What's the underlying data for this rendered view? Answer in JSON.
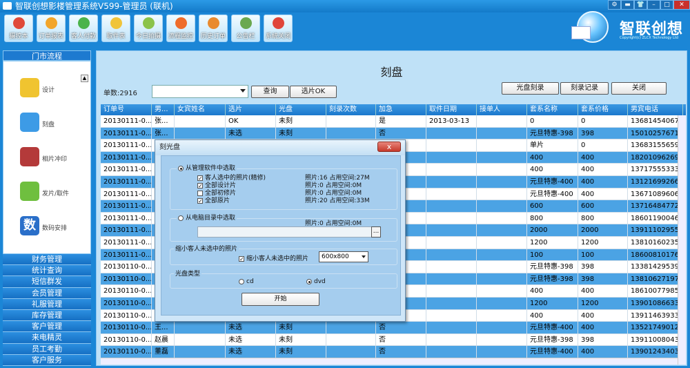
{
  "window": {
    "title": "智联创想影楼管理系统V599-管理员 (联机)",
    "buttons": [
      "⚙",
      "▬",
      "👕",
      "–",
      "□",
      "✕"
    ]
  },
  "toolbar": [
    {
      "label": "摄控本",
      "color": "#e04a3a"
    },
    {
      "label": "订单报表",
      "color": "#f2a52a"
    },
    {
      "label": "客人付款",
      "color": "#4bb34b"
    },
    {
      "label": "取件表",
      "color": "#f0c43a"
    },
    {
      "label": "今日拍摄",
      "color": "#8bc34a"
    },
    {
      "label": "流程监控",
      "color": "#ef6c2a"
    },
    {
      "label": "历史订单",
      "color": "#e98a2e"
    },
    {
      "label": "公告栏",
      "color": "#6aa84f"
    },
    {
      "label": "系统关闭",
      "color": "#e0453a"
    }
  ],
  "logo": {
    "name": "智联创想",
    "sub": "Copyright(c) ZLCX Technology Ltd"
  },
  "sidebar": {
    "header": "门市流程",
    "panel_items": [
      {
        "label": "设计",
        "icon": "design-icon",
        "color": "#f0c430"
      },
      {
        "label": "刻盘",
        "icon": "disc-icon",
        "color": "#3d9be6"
      },
      {
        "label": "相片冲印",
        "icon": "photo-print-icon",
        "color": "#b43a3a"
      },
      {
        "label": "发片/取件",
        "icon": "pickup-icon",
        "color": "#6fbf3f"
      },
      {
        "label": "数码安排",
        "icon": "digital-icon",
        "color": "#2a6fc9"
      }
    ],
    "digital_glyph": "数",
    "menu": [
      "财务管理",
      "统计查询",
      "短信群发",
      "会员管理",
      "礼服管理",
      "库存管理",
      "客户管理",
      "来电精灵",
      "员工考勤",
      "客户服务"
    ]
  },
  "main": {
    "title": "刻盘",
    "count_label": "单数:2916",
    "buttons": {
      "query": "查询",
      "select": "选片OK",
      "burn": "光盘刻录",
      "record": "刻录记录",
      "close": "关闭"
    },
    "columns": [
      "订单号",
      "男...",
      "女宾姓名",
      "选片",
      "光盘",
      "刻录次数",
      "加急",
      "取件日期",
      "接单人",
      "套系名称",
      "套系价格",
      "男宾电话"
    ],
    "rows": [
      [
        "20130111-0...",
        "张...",
        "",
        "OK",
        "未刻",
        "",
        "是",
        "2013-03-13",
        "",
        "0",
        "0",
        "13681454067"
      ],
      [
        "20130111-0...",
        "张...",
        "",
        "未选",
        "未刻",
        "",
        "否",
        "",
        "",
        "元旦特惠-398",
        "398",
        "15010257671"
      ],
      [
        "20130111-0...",
        "",
        "",
        "",
        "",
        "",
        "",
        "",
        "",
        "单片",
        "0",
        "13683155659"
      ],
      [
        "20130111-0...",
        "",
        "",
        "",
        "",
        "",
        "",
        "",
        "",
        "400",
        "400",
        "18201096269"
      ],
      [
        "20130111-0...",
        "",
        "",
        "",
        "",
        "",
        "",
        "",
        "",
        "400",
        "400",
        "13717555333"
      ],
      [
        "20130111-0...",
        "",
        "",
        "",
        "",
        "",
        "",
        "",
        "",
        "元旦特惠-400",
        "400",
        "13121699266"
      ],
      [
        "20130111-0...",
        "",
        "",
        "",
        "",
        "",
        "",
        "",
        "",
        "元旦特惠-400",
        "400",
        "13671089606"
      ],
      [
        "20130111-0...",
        "",
        "",
        "",
        "",
        "",
        "",
        "",
        "",
        "600",
        "600",
        "13716484772"
      ],
      [
        "20130111-0...",
        "",
        "",
        "",
        "",
        "",
        "",
        "",
        "",
        "800",
        "800",
        "18601190046"
      ],
      [
        "20130111-0...",
        "",
        "",
        "",
        "",
        "",
        "",
        "",
        "",
        "2000",
        "2000",
        "13911102955"
      ],
      [
        "20130111-0...",
        "",
        "",
        "",
        "",
        "",
        "",
        "",
        "",
        "1200",
        "1200",
        "13810160235"
      ],
      [
        "20130111-0...",
        "",
        "",
        "",
        "",
        "",
        "",
        "",
        "",
        "100",
        "100",
        "18600810176"
      ],
      [
        "20130110-0...",
        "",
        "",
        "",
        "",
        "",
        "",
        "",
        "",
        "元旦特惠-398",
        "398",
        "13381429539"
      ],
      [
        "20130110-0...",
        "",
        "",
        "",
        "",
        "",
        "",
        "",
        "",
        "元旦特惠-398",
        "398",
        "13810627197"
      ],
      [
        "20130110-0...",
        "",
        "",
        "",
        "",
        "",
        "",
        "",
        "",
        "400",
        "400",
        "18610077985"
      ],
      [
        "20130110-0...",
        "",
        "",
        "",
        "",
        "",
        "",
        "",
        "",
        "1200",
        "1200",
        "13901086633"
      ],
      [
        "20130110-0...",
        "",
        "",
        "",
        "",
        "",
        "",
        "",
        "",
        "400",
        "400",
        "13911463933"
      ],
      [
        "20130110-0...",
        "王...",
        "",
        "未选",
        "未刻",
        "",
        "否",
        "",
        "",
        "元旦特惠-400",
        "400",
        "13521749012"
      ],
      [
        "20130110-0...",
        "赵晨",
        "",
        "未选",
        "未刻",
        "",
        "否",
        "",
        "",
        "元旦特惠-398",
        "398",
        "13911008043"
      ],
      [
        "20130110-0...",
        "董磊",
        "",
        "未选",
        "未刻",
        "",
        "否",
        "",
        "",
        "元旦特惠-400",
        "400",
        "13901243403"
      ]
    ]
  },
  "dialog": {
    "title": "刻光盘",
    "close": "x",
    "group1": {
      "title": "从管理软件中选取",
      "options": [
        {
          "label": "客人选中的照片(精修)",
          "checked": true,
          "info": "照片:16 占用空间:27M"
        },
        {
          "label": "全部设计片",
          "checked": true,
          "info": "照片:0 占用空间:0M"
        },
        {
          "label": "全部初修片",
          "checked": false,
          "info": "照片:0 占用空间:0M"
        },
        {
          "label": "全部原片",
          "checked": true,
          "info": "照片:20 占用空间:33M"
        }
      ]
    },
    "group2": {
      "title": "从电脑目录中选取",
      "info": "照片:0 占用空间:0M",
      "browse": "..."
    },
    "group3": {
      "title": "缩小客人未选中的照片",
      "option": "缩小客人未选中的照片",
      "size": "600x800"
    },
    "group4": {
      "title": "光盘类型",
      "cd": "cd",
      "dvd": "dvd"
    },
    "start": "开始"
  }
}
